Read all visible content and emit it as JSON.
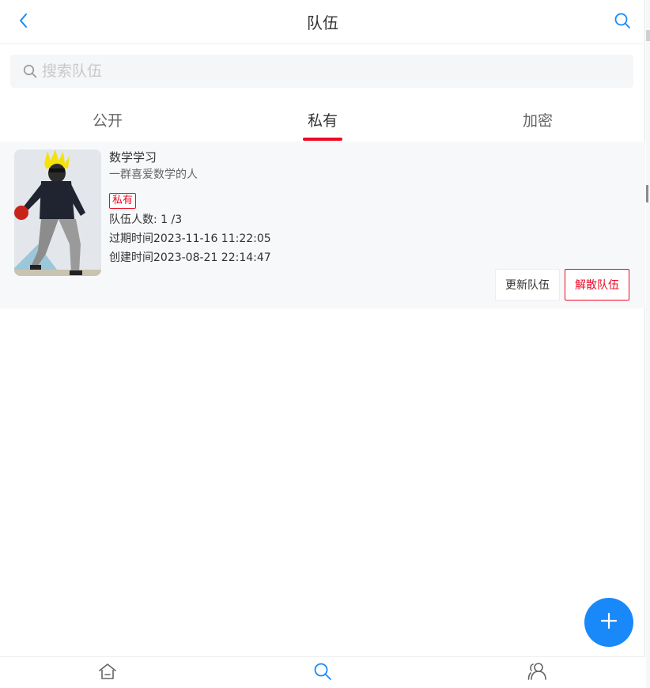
{
  "navbar": {
    "title": "队伍",
    "back_icon": "chevron-left-icon",
    "search_icon": "search-icon"
  },
  "search": {
    "placeholder": "搜索队伍",
    "value": ""
  },
  "tabs": [
    {
      "label": "公开",
      "active": false
    },
    {
      "label": "私有",
      "active": true
    },
    {
      "label": "加密",
      "active": false
    }
  ],
  "team": {
    "name": "数学学习",
    "description": "一群喜爱数学的人",
    "tag": "私有",
    "members": "队伍人数: 1 /3",
    "expire": "过期时间2023-11-16 11:22:05",
    "created": "创建时间2023-08-21 22:14:47",
    "update_label": "更新队伍",
    "dissolve_label": "解散队伍"
  },
  "fab": {
    "icon": "plus-icon"
  },
  "tabbar": [
    {
      "icon": "home-icon",
      "active": false
    },
    {
      "icon": "search-icon",
      "active": true
    },
    {
      "icon": "team-icon",
      "active": false
    }
  ],
  "colors": {
    "accent_blue": "#1989fa",
    "danger_red": "#ee0a24",
    "text": "#323233",
    "muted_text": "#646566",
    "card_bg": "#f7f8fa"
  }
}
